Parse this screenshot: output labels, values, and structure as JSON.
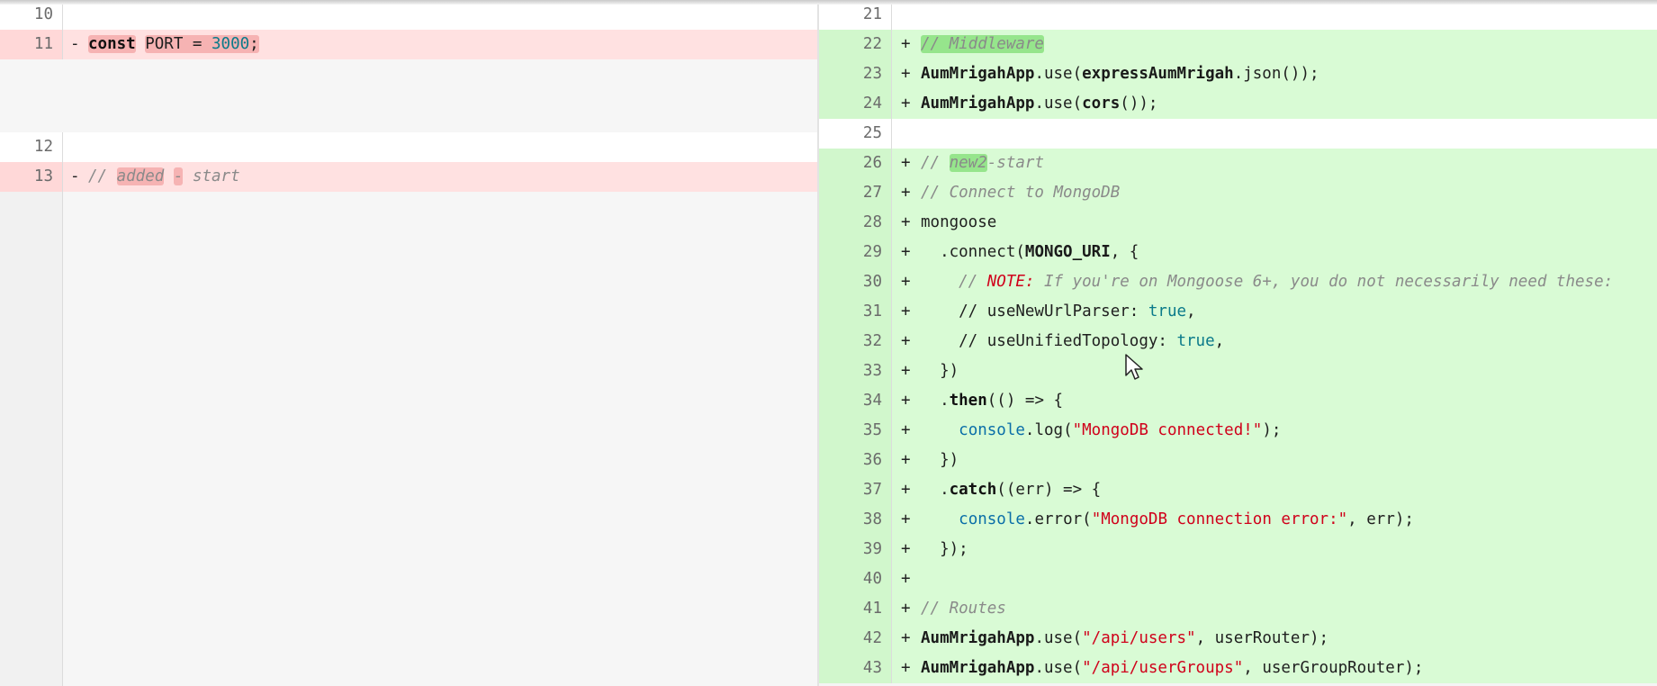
{
  "left": {
    "lines": {
      "l10": "10",
      "l11": {
        "num": "11",
        "marker": "-",
        "kw": "const",
        "name": "PORT",
        "eq": " = ",
        "value": "3000",
        "end": ";"
      },
      "l12": "12",
      "l13": {
        "num": "13",
        "marker": "-",
        "c1": "// ",
        "c2": "added",
        "c3": " ",
        "c4": "-",
        "c5": " ",
        "c6": "start"
      }
    }
  },
  "right": {
    "lines": {
      "l21": "21",
      "l22": {
        "num": "22",
        "marker": "+",
        "c1": "//",
        "c2": " Middleware"
      },
      "l23": {
        "num": "23",
        "marker": "+",
        "app": "AumMrigahApp",
        "use": ".use(",
        "fn": "expressAumMrigah",
        "rest": ".json());"
      },
      "l24": {
        "num": "24",
        "marker": "+",
        "app": "AumMrigahApp",
        "use": ".use(",
        "fn": "cors",
        "rest": "());"
      },
      "l25": "25",
      "l26": {
        "num": "26",
        "marker": "+",
        "c1": "// ",
        "c2": "new2",
        "c3": "-start"
      },
      "l27": {
        "num": "27",
        "marker": "+",
        "text": "// Connect to MongoDB"
      },
      "l28": {
        "num": "28",
        "marker": "+",
        "text": "mongoose"
      },
      "l29": {
        "num": "29",
        "marker": "+",
        "pre": "  .connect(",
        "id": "MONGO_URI",
        "post": ", {"
      },
      "l30": {
        "num": "30",
        "marker": "+",
        "pre": "    // ",
        "note": "NOTE:",
        "post": " If you're on Mongoose 6+, you do not necessarily need these:"
      },
      "l31": {
        "num": "31",
        "marker": "+",
        "pre": "    // useNewUrlParser: ",
        "val": "true",
        "post": ","
      },
      "l32": {
        "num": "32",
        "marker": "+",
        "pre": "    // useUnifiedTopology: ",
        "val": "true",
        "post": ","
      },
      "l33": {
        "num": "33",
        "marker": "+",
        "text": "  })"
      },
      "l34": {
        "num": "34",
        "marker": "+",
        "pre": "  .",
        "kw": "then",
        "post": "(() => {"
      },
      "l35": {
        "num": "35",
        "marker": "+",
        "pre": "    ",
        "bi": "console",
        "mid": ".log(",
        "str": "\"MongoDB connected!\"",
        "post": ");"
      },
      "l36": {
        "num": "36",
        "marker": "+",
        "text": "  })"
      },
      "l37": {
        "num": "37",
        "marker": "+",
        "pre": "  .",
        "kw": "catch",
        "post": "((err) => {"
      },
      "l38": {
        "num": "38",
        "marker": "+",
        "pre": "    ",
        "bi": "console",
        "mid": ".error(",
        "str": "\"MongoDB connection error:\"",
        "post": ", err);"
      },
      "l39": {
        "num": "39",
        "marker": "+",
        "text": "  });"
      },
      "l40": {
        "num": "40",
        "marker": "+"
      },
      "l41": {
        "num": "41",
        "marker": "+",
        "text": "// Routes"
      },
      "l42": {
        "num": "42",
        "marker": "+",
        "app": "AumMrigahApp",
        "use": ".use(",
        "str": "\"/api/users\"",
        "post": ", userRouter);"
      },
      "l43": {
        "num": "43",
        "marker": "+",
        "app": "AumMrigahApp",
        "use": ".use(",
        "str": "\"/api/userGroups\"",
        "post": ", userGroupRouter);"
      }
    }
  },
  "colors": {
    "added_bg": "#d9fbd5",
    "removed_bg": "#ffe1e1",
    "added_highlight": "#96e58c",
    "removed_highlight": "#f6b3b3",
    "string": "#d0011b",
    "number": "#0a7a8a"
  }
}
